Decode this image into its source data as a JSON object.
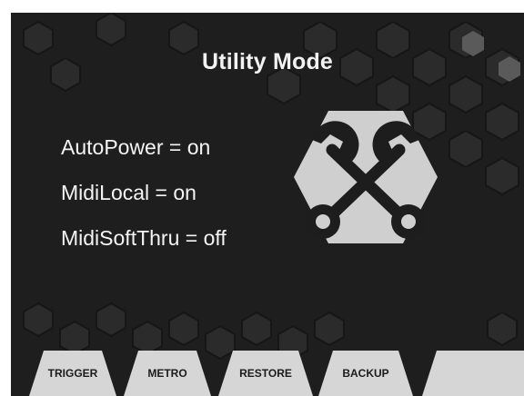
{
  "screen": {
    "title": "Utility Mode",
    "settings": [
      {
        "label": "AutoPower = on"
      },
      {
        "label": "MidiLocal = on"
      },
      {
        "label": "MidiSoftThru = off"
      }
    ],
    "icon": "wrench-cross-icon",
    "softkeys": [
      {
        "label": "TRIGGER"
      },
      {
        "label": "METRO"
      },
      {
        "label": "RESTORE"
      },
      {
        "label": "BACKUP"
      },
      {
        "label": ""
      }
    ]
  },
  "colors": {
    "background": "#1e1e1e",
    "text": "#f2f2f2",
    "softkey": "#d6d6d6",
    "hexagon": "#d0d0d0"
  }
}
